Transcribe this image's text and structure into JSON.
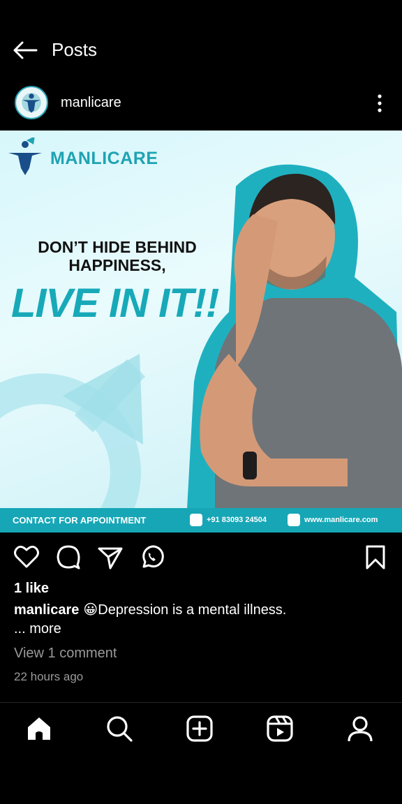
{
  "header": {
    "title": "Posts"
  },
  "author": {
    "username": "manlicare"
  },
  "post_image": {
    "brand": "MANLICARE",
    "headline_line1": "DON’T HIDE BEHIND",
    "headline_line2": "HAPPINESS,",
    "headline_big": "LIVE IN IT!!",
    "footer_contact": "CONTACT FOR APPOINTMENT",
    "footer_phone": "+91 83093 24504",
    "footer_website": "www.manlicare.com",
    "accent_color": "#17a6b6"
  },
  "actions": {
    "icons": [
      "heart-icon",
      "comment-icon",
      "share-icon",
      "whatsapp-icon",
      "bookmark-icon"
    ]
  },
  "likes_text": "1 like",
  "caption": {
    "username": "manlicare",
    "emoji": "😀",
    "text": "Depression is a mental illness."
  },
  "more_text": "... more",
  "comments_text": "View 1 comment",
  "timestamp": "22 hours ago",
  "bottom_nav": [
    "home-icon",
    "search-icon",
    "create-icon",
    "reels-icon",
    "profile-icon"
  ]
}
